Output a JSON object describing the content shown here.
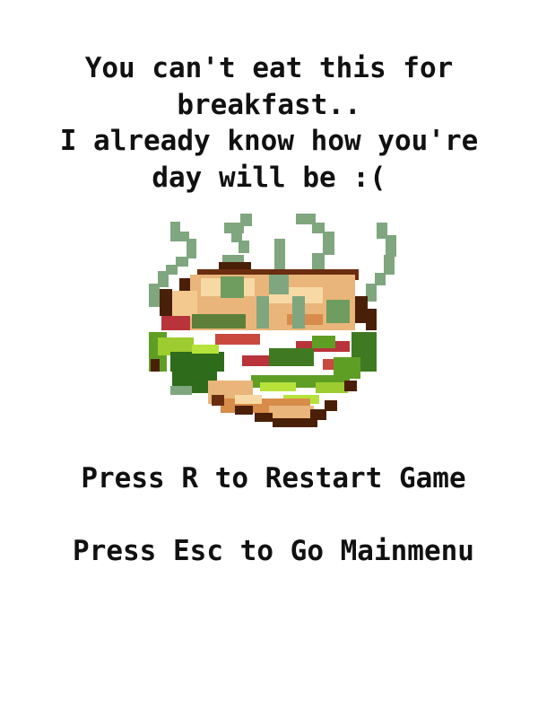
{
  "game_over": {
    "message_lines": [
      "You can't eat this for",
      "breakfast..",
      "I already know how you're",
      "day will be :("
    ],
    "restart_prompt": "Press R to Restart Game",
    "menu_prompt": "Press Esc to Go Mainmenu"
  },
  "sprite": {
    "name": "steaming-sandwich",
    "colors": {
      "steam": "#7fa67f",
      "outline": "#4a1f08",
      "bread_light": "#f7d9a5",
      "bread_mid": "#e9b57a",
      "bread_dark": "#d88c49",
      "lettuce_light": "#b6e23a",
      "lettuce_mid": "#5f9e25",
      "lettuce_dark": "#2e6b1a",
      "tomato": "#b8333a",
      "mold": "#6f9c5f"
    }
  }
}
